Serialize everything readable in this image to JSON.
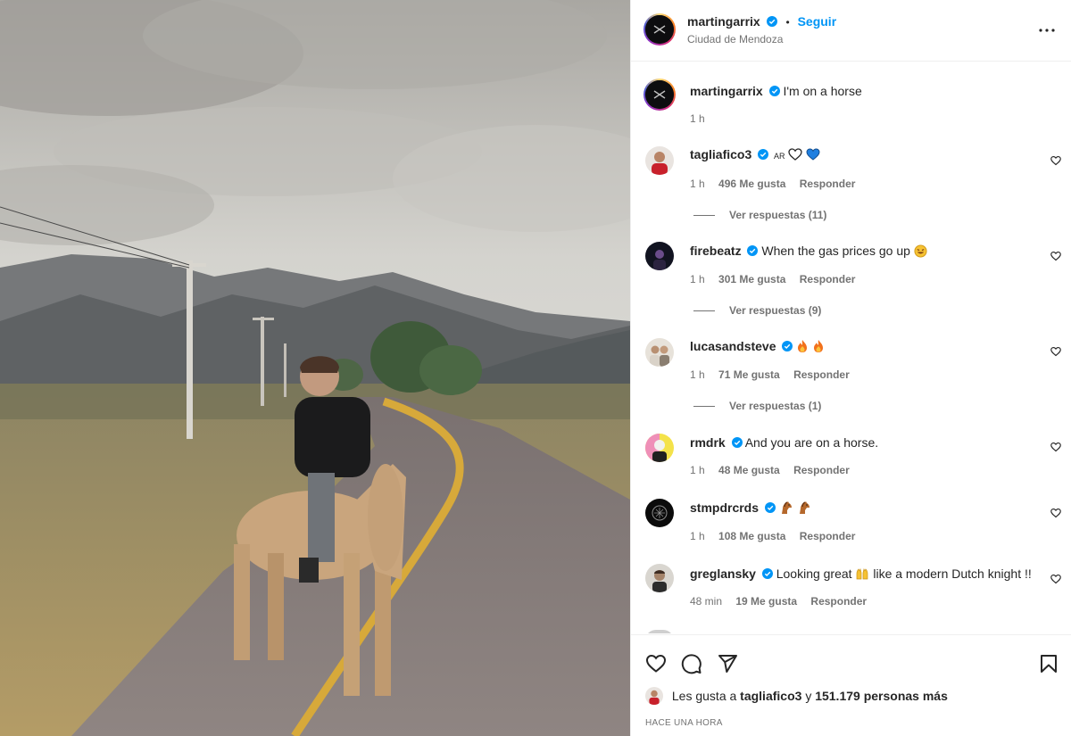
{
  "post": {
    "author": "martingarrix",
    "follow_label": "Seguir",
    "location": "Ciudad de Mendoza",
    "caption": "I'm on a horse",
    "caption_time": "1 h"
  },
  "comments": [
    {
      "user": "tagliafico3",
      "text": "",
      "suffix_small": "AR",
      "emojis": [
        "heart-outline",
        "blue-heart"
      ],
      "time": "1 h",
      "likes": "496 Me gusta",
      "reply": "Responder",
      "view_replies": "Ver respuestas (11)",
      "avatar": "avatar-red-jersey"
    },
    {
      "user": "firebeatz",
      "text": "When the gas prices go up",
      "emojis": [
        "rofl-emoji"
      ],
      "time": "1 h",
      "likes": "301 Me gusta",
      "reply": "Responder",
      "view_replies": "Ver respuestas (9)",
      "avatar": "avatar-dark-stage"
    },
    {
      "user": "lucasandsteve",
      "text": "",
      "emojis": [
        "fire-emoji",
        "fire-emoji"
      ],
      "time": "1 h",
      "likes": "71 Me gusta",
      "reply": "Responder",
      "view_replies": "Ver respuestas (1)",
      "avatar": "avatar-duo"
    },
    {
      "user": "rmdrk",
      "text": "And you are on a horse.",
      "emojis": [],
      "time": "1 h",
      "likes": "48 Me gusta",
      "reply": "Responder",
      "view_replies": "",
      "avatar": "avatar-pink-yellow"
    },
    {
      "user": "stmpdrcrds",
      "text": "",
      "emojis": [
        "horse-emoji",
        "horse-emoji"
      ],
      "time": "1 h",
      "likes": "108 Me gusta",
      "reply": "Responder",
      "view_replies": "",
      "avatar": "avatar-black-logo"
    },
    {
      "user": "greglansky",
      "text": "Looking great",
      "text_after": "like a modern Dutch knight !!",
      "emojis": [
        "raised-hands-emoji"
      ],
      "time": "48 min",
      "likes": "19 Me gusta",
      "reply": "Responder",
      "view_replies": "",
      "avatar": "avatar-portrait"
    }
  ],
  "liked_by": {
    "prefix": "Les gusta a",
    "user": "tagliafico3",
    "connector": "y",
    "count": "151.179 personas más"
  },
  "timestamp": "HACE UNA HORA",
  "colors": {
    "link_blue": "#0095f6",
    "verified_blue": "#0095f6",
    "secondary_text": "#737373",
    "primary_text": "#262626"
  }
}
